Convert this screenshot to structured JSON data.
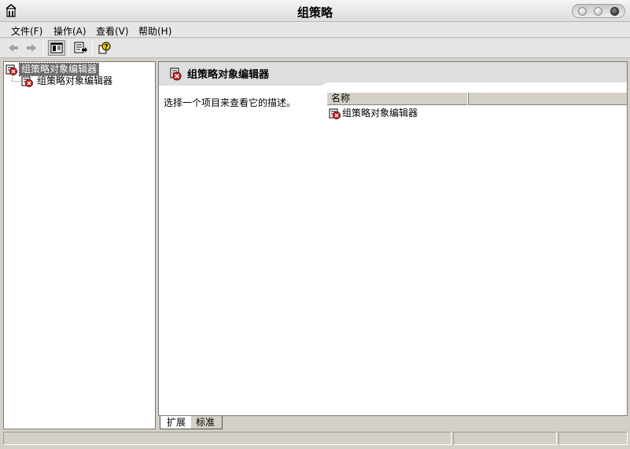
{
  "window": {
    "title": "组策略"
  },
  "menu": [
    {
      "label": "文件(F)"
    },
    {
      "label": "操作(A)"
    },
    {
      "label": "查看(V)"
    },
    {
      "label": "帮助(H)"
    }
  ],
  "toolbar": {
    "buttons": [
      {
        "icon": "back-arrow-icon",
        "enabled": false
      },
      {
        "icon": "forward-arrow-icon",
        "enabled": false
      },
      {
        "icon": "show-hide-console-tree-icon",
        "pressed": true
      },
      {
        "icon": "export-list-icon"
      },
      {
        "icon": "help-icon"
      }
    ]
  },
  "tree": {
    "root": {
      "label": "组策略对象编辑器",
      "icon": "gpo-editor-icon",
      "selected": true
    },
    "child": {
      "label": "组策略对象编辑器",
      "icon": "gpo-editor-icon"
    }
  },
  "details": {
    "header_title": "组策略对象编辑器",
    "description": "选择一个项目来查看它的描述。",
    "columns": [
      {
        "label": "名称"
      },
      {
        "label": ""
      }
    ],
    "rows": [
      {
        "name": "组策略对象编辑器",
        "icon": "gpo-editor-icon"
      }
    ]
  },
  "tabs": [
    {
      "label": "扩展",
      "active": true
    },
    {
      "label": "标准",
      "active": false
    }
  ],
  "colors": {
    "selection": "#6c6c6c",
    "icon_red": "#d42020"
  }
}
